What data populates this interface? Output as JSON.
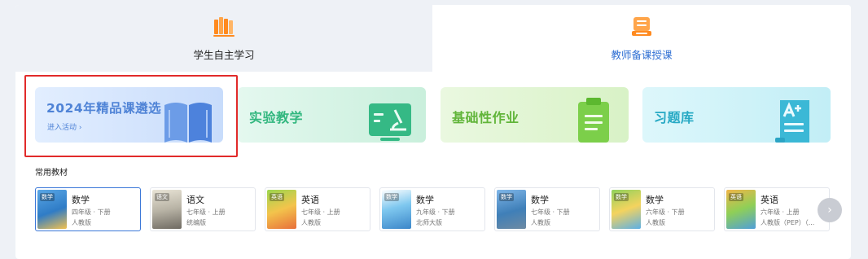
{
  "tabs": [
    {
      "label": "学生自主学习",
      "icon": "books-icon",
      "selected": true
    },
    {
      "label": "教师备课授课",
      "icon": "teacher-board-icon",
      "selected": false
    }
  ],
  "cards": [
    {
      "title": "2024年精品课遴选",
      "link": "进入活动 ›",
      "icon": "open-book-icon"
    },
    {
      "title": "实验教学",
      "icon": "microscope-board-icon"
    },
    {
      "title": "基础性作业",
      "icon": "clipboard-icon"
    },
    {
      "title": "习题库",
      "icon": "exam-paper-icon"
    }
  ],
  "textbooks": {
    "title": "常用教材",
    "next_label": "›",
    "items": [
      {
        "cover_tag": "数学",
        "subject": "数学",
        "grade": "四年级 · 下册",
        "publisher": "人教版"
      },
      {
        "cover_tag": "语文",
        "subject": "语文",
        "grade": "七年级 · 上册",
        "publisher": "统编版"
      },
      {
        "cover_tag": "英语",
        "subject": "英语",
        "grade": "七年级 · 上册",
        "publisher": "人教版"
      },
      {
        "cover_tag": "数学",
        "subject": "数学",
        "grade": "九年级 · 下册",
        "publisher": "北师大版"
      },
      {
        "cover_tag": "数学",
        "subject": "数学",
        "grade": "七年级 · 下册",
        "publisher": "人教版"
      },
      {
        "cover_tag": "数学",
        "subject": "数学",
        "grade": "六年级 · 下册",
        "publisher": "人教版"
      },
      {
        "cover_tag": "英语",
        "subject": "英语",
        "grade": "六年级 · 上册",
        "publisher": "人教版（PEP）（..."
      }
    ]
  },
  "colors": {
    "accent_blue": "#2f6fd3",
    "highlight_red": "#e12a2a",
    "icon_orange": "#ff8a1f"
  }
}
